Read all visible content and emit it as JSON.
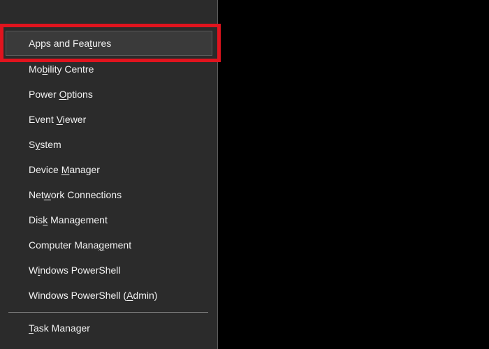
{
  "context_menu": {
    "items": [
      {
        "before": "Apps and Fea",
        "accel": "t",
        "after": "ures"
      },
      {
        "before": "Mo",
        "accel": "b",
        "after": "ility Centre"
      },
      {
        "before": "Power ",
        "accel": "O",
        "after": "ptions"
      },
      {
        "before": "Event ",
        "accel": "V",
        "after": "iewer"
      },
      {
        "before": "S",
        "accel": "y",
        "after": "stem"
      },
      {
        "before": "Device ",
        "accel": "M",
        "after": "anager"
      },
      {
        "before": "Net",
        "accel": "w",
        "after": "ork Connections"
      },
      {
        "before": "Dis",
        "accel": "k",
        "after": " Management"
      },
      {
        "before": "Computer Mana",
        "accel": "g",
        "after": "ement"
      },
      {
        "before": "W",
        "accel": "i",
        "after": "ndows PowerShell"
      },
      {
        "before": "Windows PowerShell (",
        "accel": "A",
        "after": "dmin)"
      },
      {
        "before": "",
        "accel": "T",
        "after": "ask Manager"
      }
    ],
    "highlighted_index": 0
  },
  "colors": {
    "background": "#000000",
    "menu_background": "#2b2b2b",
    "highlight": "#3a3a3a",
    "annotation": "#e0141e",
    "text": "#f2f2f2"
  }
}
